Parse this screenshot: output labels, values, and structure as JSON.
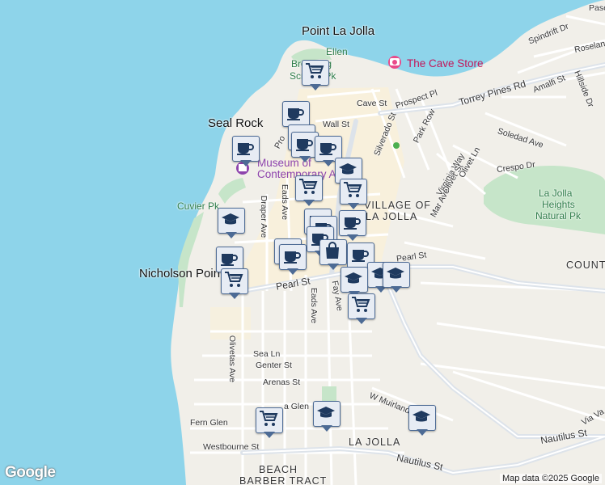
{
  "colors": {
    "water": "#8ed4ea",
    "land": "#f1efe9",
    "park": "#c6e5c9",
    "road": "#ffffff",
    "major_road": "#dde3ea",
    "commercial": "#faf0d8",
    "marker_border": "#4d6b95",
    "marker_fill": "#e7ecf4",
    "marker_icon": "#1f3a5f"
  },
  "labels": {
    "point_la_jolla": "Point La Jolla",
    "seal_rock": "Seal Rock",
    "nicholson_point": "Nicholson Point",
    "cuvier_pk": "Cuvier Pk",
    "ellen": "Ellen",
    "browning": "Browning",
    "scripps_pk": "Scripps Pk",
    "cave_store": "The Cave Store",
    "museum_line1": "Museum of",
    "museum_line2": "Contemporary Art...",
    "village_line1": "VILLAGE OF",
    "village_line2": "LA JOLLA",
    "la_jolla_heights_1": "La Jolla",
    "la_jolla_heights_2": "Heights",
    "la_jolla_heights_3": "Natural Pk",
    "country": "COUNT",
    "la_jolla": "LA JOLLA",
    "beach": "BEACH",
    "barber_tract": "BARBER TRACT"
  },
  "streets": {
    "prospect_pl": "Prospect Pl",
    "torrey_pines_rd": "Torrey Pines Rd",
    "cave_st": "Cave St",
    "wall_st": "Wall St",
    "silverado_st": "Silverado St",
    "park_row": "Park Row",
    "prospect": "Pro",
    "virginia_way": "Virginia Way",
    "olivet_st": "Olivet St",
    "olivet_ln": "Olivet Ln",
    "mar_ave": "Mar Ave",
    "soledad_ave": "Soledad Ave",
    "crespo_dr": "Crespo Dr",
    "amalfi_st": "Amalfi St",
    "hillside_dr": "Hillside Dr",
    "spindrift_dr": "Spindrift Dr",
    "roseland": "Roselan",
    "pase": "Pase",
    "eads_ave_n": "Eads Ave",
    "draper_ave": "Draper Ave",
    "pearl_st": "Pearl St",
    "pearl_st_e": "Pearl St",
    "eads_ave_s": "Eads Ave",
    "fay_ave": "Fay Ave",
    "olivetas_ave": "Olivetas Ave",
    "sea_ln": "Sea Ln",
    "genter_st": "Genter St",
    "arenas_st": "Arenas St",
    "glen": "a Glen",
    "fern_glen": "Fern Glen",
    "westbourne_st": "Westbourne St",
    "w_muirlands": "W Muirlands",
    "nautilus_st": "Nautilus St",
    "nautilus_st_2": "Nautilus St",
    "via_va": "Via Va"
  },
  "markers": [
    {
      "type": "shopping-cart",
      "lon": 389,
      "lat": 92
    },
    {
      "type": "coffee-cup",
      "lon": 365,
      "lat": 143
    },
    {
      "type": "coffee-cup",
      "lon": 372,
      "lat": 172
    },
    {
      "type": "coffee-cup",
      "lon": 376,
      "lat": 181
    },
    {
      "type": "coffee-cup",
      "lon": 405,
      "lat": 186
    },
    {
      "type": "coffee-cup",
      "lon": 303,
      "lat": 186
    },
    {
      "type": "graduation-cap",
      "lon": 430,
      "lat": 213
    },
    {
      "type": "shopping-cart",
      "lon": 381,
      "lat": 235
    },
    {
      "type": "shopping-cart",
      "lon": 436,
      "lat": 239
    },
    {
      "type": "graduation-cap",
      "lon": 285,
      "lat": 275
    },
    {
      "type": "coffee-cup",
      "lon": 435,
      "lat": 278
    },
    {
      "type": "coffee-cup",
      "lon": 392,
      "lat": 276
    },
    {
      "type": "coffee-cup",
      "lon": 399,
      "lat": 285
    },
    {
      "type": "coffee-cup",
      "lon": 395,
      "lat": 298
    },
    {
      "type": "coffee-cup",
      "lon": 355,
      "lat": 313
    },
    {
      "type": "coffee-cup",
      "lon": 361,
      "lat": 320
    },
    {
      "type": "shopping-bag",
      "lon": 411,
      "lat": 314
    },
    {
      "type": "coffee-cup",
      "lon": 445,
      "lat": 318
    },
    {
      "type": "coffee-cup",
      "lon": 283,
      "lat": 323
    },
    {
      "type": "graduation-cap",
      "lon": 470,
      "lat": 342
    },
    {
      "type": "graduation-cap",
      "lon": 489,
      "lat": 342
    },
    {
      "type": "graduation-cap",
      "lon": 437,
      "lat": 348
    },
    {
      "type": "shopping-cart",
      "lon": 289,
      "lat": 350
    },
    {
      "type": "shopping-cart",
      "lon": 446,
      "lat": 381
    },
    {
      "type": "graduation-cap",
      "lon": 403,
      "lat": 514
    },
    {
      "type": "graduation-cap",
      "lon": 521,
      "lat": 519
    },
    {
      "type": "shopping-cart",
      "lon": 332,
      "lat": 522
    }
  ],
  "footer": {
    "google": "Google",
    "map_data": "Map data ©2025 Google"
  }
}
